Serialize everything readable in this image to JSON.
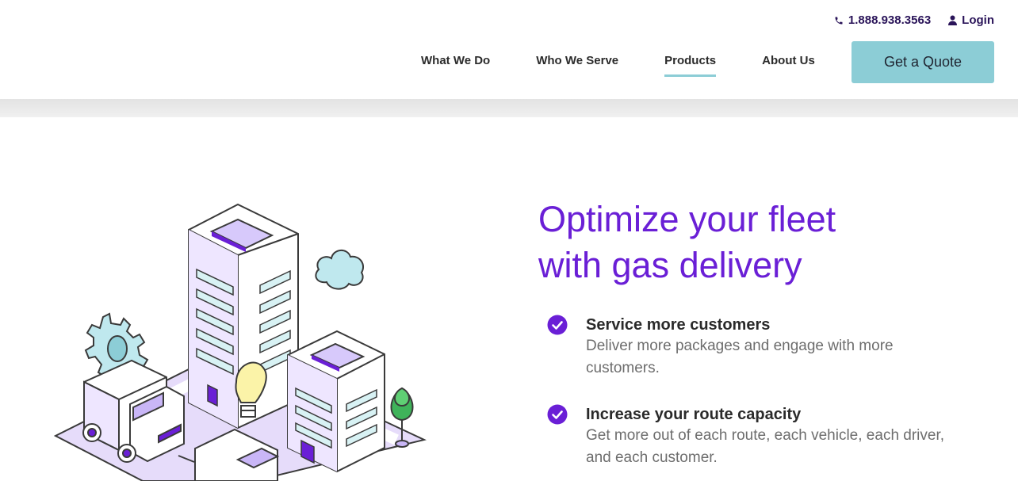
{
  "header": {
    "phone": "1.888.938.3563",
    "login": "Login",
    "nav": [
      {
        "label": "What We Do",
        "active": false
      },
      {
        "label": "Who We Serve",
        "active": false
      },
      {
        "label": "Products",
        "active": true
      },
      {
        "label": "About Us",
        "active": false
      }
    ],
    "cta": "Get a Quote"
  },
  "hero": {
    "title_line1": "Optimize your fleet",
    "title_line2": "with gas delivery",
    "features": [
      {
        "title": "Service more customers",
        "desc": "Deliver more packages and engage with more customers."
      },
      {
        "title": "Increase your route capacity",
        "desc": "Get more out of each route, each vehicle, each driver, and each customer."
      }
    ]
  },
  "colors": {
    "brand_purple": "#6a1fd6",
    "accent_teal": "#8ccdd6",
    "nav_dark": "#2a1459"
  },
  "icons": [
    "phone-icon",
    "user-icon",
    "check-circle-icon",
    "city-fleet-illustration"
  ]
}
